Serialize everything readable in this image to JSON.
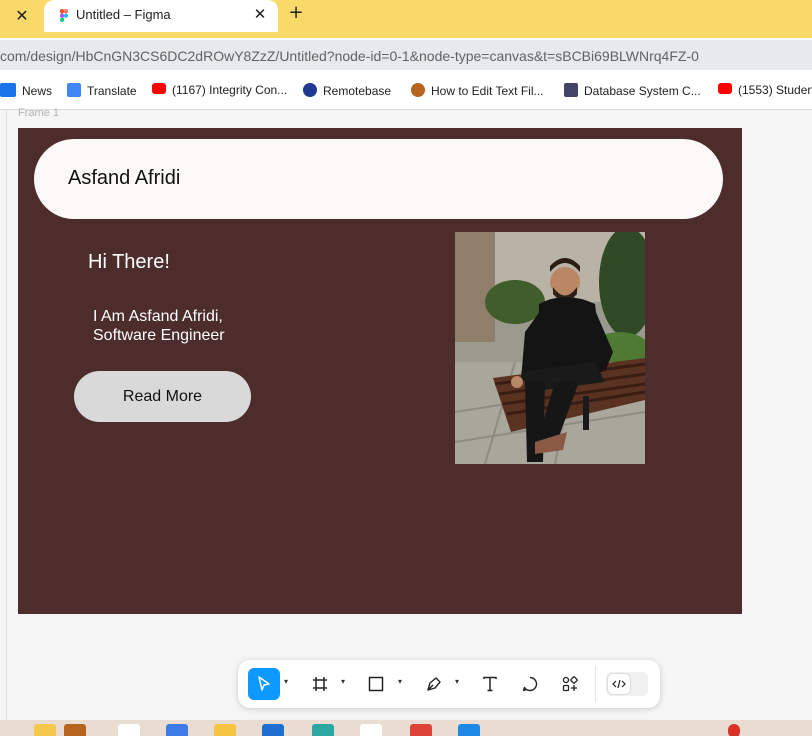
{
  "browser": {
    "prev_tab_close": "✕",
    "active_tab": {
      "title": "Untitled – Figma",
      "close": "✕"
    },
    "new_tab": "+",
    "url": "com/design/HbCnGN3CS6DC2dROwY8ZzZ/Untitled?node-id=0-1&node-type=canvas&t=sBCBi69BLWNrq4FZ-0",
    "bookmarks": [
      {
        "label": "News",
        "icon": "news-icon",
        "color": "#1a73e8"
      },
      {
        "label": "Translate",
        "icon": "translate-icon",
        "color": "#4285f4"
      },
      {
        "label": "(1167) Integrity Con...",
        "icon": "youtube-icon",
        "color": "#ff0000"
      },
      {
        "label": "Remotebase",
        "icon": "remotebase-icon",
        "color": "#1f3a93"
      },
      {
        "label": "How to Edit Text Fil...",
        "icon": "bookmark-site-icon",
        "color": "#b5651d"
      },
      {
        "label": "Database System C...",
        "icon": "bookmark-site-icon",
        "color": "#444466"
      },
      {
        "label": "(1553) Studen",
        "icon": "youtube-icon",
        "color": "#ff0000"
      }
    ]
  },
  "canvas": {
    "frame_label": "Frame 1",
    "frame_color": "#4d2c2c",
    "design": {
      "nav_name": "Asfand Afridi",
      "greeting": "Hi There!",
      "intro_line1": "I Am Asfand Afridi,",
      "intro_line2": "Software Engineer",
      "button_label": "Read More"
    }
  },
  "toolbar": {
    "tools": [
      {
        "name": "move-tool",
        "selected": true
      },
      {
        "name": "frame-tool",
        "selected": false
      },
      {
        "name": "rectangle-tool",
        "selected": false
      },
      {
        "name": "pen-tool",
        "selected": false
      },
      {
        "name": "text-tool",
        "selected": false
      },
      {
        "name": "comment-tool",
        "selected": false
      },
      {
        "name": "actions-tool",
        "selected": false
      }
    ],
    "dev_mode": "dev-mode-toggle",
    "accent": "#0d99ff"
  }
}
